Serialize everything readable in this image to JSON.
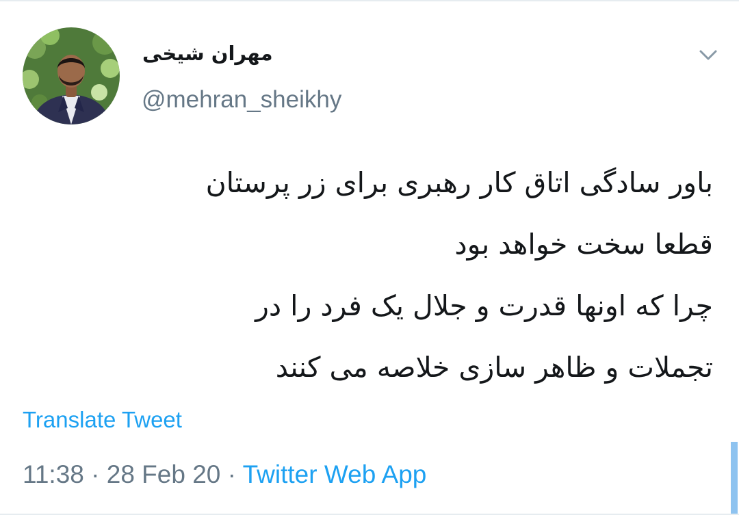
{
  "tweet": {
    "author": {
      "display_name": "مهران شیخی",
      "handle": "@mehran_sheikhy",
      "avatar_icon": "profile-photo"
    },
    "menu_icon": "chevron-down-icon",
    "text_lines": [
      "باور سادگی اتاق کار رهبری برای زر پرستان",
      "قطعا سخت خواهد بود",
      "چرا که اونها قدرت و جلال یک فرد را در",
      "تجملات و ظاهر سازی خلاصه می کنند"
    ],
    "translate_label": "Translate Tweet",
    "time": "11:38",
    "separator": "·",
    "date": "28 Feb 20",
    "source": "Twitter Web App"
  },
  "colors": {
    "text": "#14171a",
    "secondary": "#657786",
    "link": "#1da1f2",
    "divider": "#e6ecf0"
  }
}
